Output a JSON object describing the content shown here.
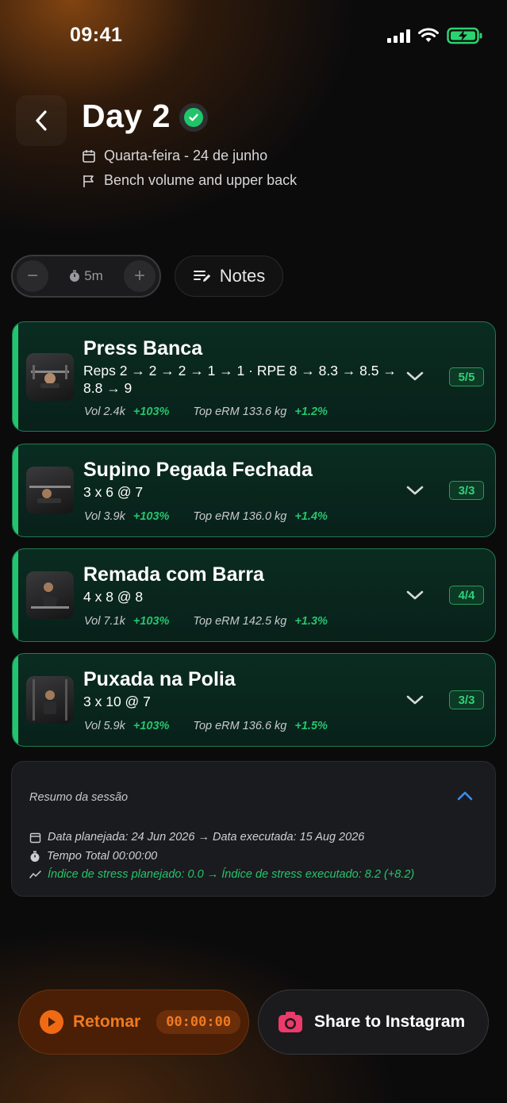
{
  "status_bar": {
    "time": "09:41"
  },
  "header": {
    "title": "Day 2",
    "date": "Quarta-feira - 24 de junho",
    "focus": "Bench volume and upper back"
  },
  "controls": {
    "timer_value": "5m",
    "minus": "−",
    "plus": "+",
    "notes_label": "Notes"
  },
  "exercises": [
    {
      "name": "Press Banca",
      "sets_line1": "Reps 2 → 2 → 2 → 1 → 1 · RPE 8 → 8.3 → 8.5 →",
      "sets_line2": "8.8 → 9",
      "vol": "Vol 2.4k",
      "vol_delta": "+103%",
      "erm": "Top eRM 133.6 kg",
      "erm_delta": "+1.2%",
      "badge": "5/5"
    },
    {
      "name": "Supino Pegada Fechada",
      "sets_line1": "3 x 6 @ 7",
      "vol": "Vol 3.9k",
      "vol_delta": "+103%",
      "erm": "Top eRM 136.0 kg",
      "erm_delta": "+1.4%",
      "badge": "3/3"
    },
    {
      "name": "Remada com Barra",
      "sets_line1": "4 x 8 @ 8",
      "vol": "Vol 7.1k",
      "vol_delta": "+103%",
      "erm": "Top eRM 142.5 kg",
      "erm_delta": "+1.3%",
      "badge": "4/4"
    },
    {
      "name": "Puxada na Polia",
      "sets_line1": "3 x 10 @ 7",
      "vol": "Vol 5.9k",
      "vol_delta": "+103%",
      "erm": "Top eRM 136.6 kg",
      "erm_delta": "+1.5%",
      "badge": "3/3"
    }
  ],
  "summary": {
    "title": "Resumo da sessão",
    "dates": "Data planejada: 24 Jun 2026 → Data executada: 15 Aug 2026",
    "total_time": "Tempo Total 00:00:00",
    "stress": "Índice de stress planejado: 0.0 → Índice de stress executado: 8.2 (+8.2)"
  },
  "footer": {
    "resume_label": "Retomar",
    "resume_timer": "00:00:00",
    "share_label": "Share to Instagram"
  },
  "colors": {
    "accent_green": "#21c56d",
    "accent_orange": "#f06a14",
    "background": "#0b0b0c"
  }
}
